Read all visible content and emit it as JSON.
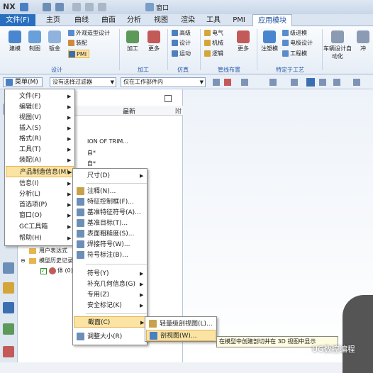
{
  "titlebar": {
    "logo": "NX",
    "window_menu": "窗口"
  },
  "tabs": [
    "文件(F)",
    "主页",
    "曲线",
    "曲面",
    "分析",
    "视图",
    "渲染",
    "工具",
    "PMI",
    "应用模块"
  ],
  "ribbon": {
    "design": {
      "label": "设计",
      "big": [
        "建模",
        "制图",
        "钣金"
      ],
      "small": [
        "外观造型设计",
        "装配",
        "PMI"
      ]
    },
    "process": {
      "label": "加工",
      "big": [
        "加工",
        "更多"
      ]
    },
    "sim": {
      "label": "仿真",
      "small": [
        "高级",
        "设计",
        "运动"
      ]
    },
    "pipe": {
      "label": "管线布置",
      "small": [
        "电气",
        "机械",
        "逻辑"
      ],
      "more": "更多"
    },
    "special": {
      "label": "特定于工艺",
      "big": [
        "注塑模"
      ],
      "small": [
        "级进模",
        "电极设计",
        "工程模"
      ]
    },
    "extra": {
      "items": [
        "车辆设计自动化",
        "冲"
      ]
    }
  },
  "cmdbar": {
    "menu": "菜单(M)",
    "filter": "没有选择过滤器",
    "scope": "仅在工作部件内"
  },
  "nav": {
    "col_latest": "最新",
    "col_p": "附",
    "rows": [
      "ION OF TRIM...",
      "自*",
      "自*"
    ],
    "user_expr": "用户表达式",
    "history": "模型历史记录",
    "body": "体 (0)"
  },
  "menu1": [
    "文件(F)",
    "编辑(E)",
    "视图(V)",
    "插入(S)",
    "格式(R)",
    "工具(T)",
    "装配(A)",
    "产品制造信息(M)",
    "信息(I)",
    "分析(L)",
    "首选项(P)",
    "窗口(O)",
    "GC工具箱",
    "帮助(H)"
  ],
  "menu2": {
    "items": [
      "尺寸(D)",
      "注释(N)...",
      "特征控制框(F)...",
      "基准特征符号(A)...",
      "基准目标(T)...",
      "表面粗糙度(S)...",
      "焊接符号(W)...",
      "符号标注(B)...",
      "符号(Y)",
      "补充几何信息(G)",
      "专用(Z)",
      "安全标记(K)",
      "截面(C)",
      "调整大小(R)"
    ]
  },
  "menu3": [
    "轻量级剖视图(L)...",
    "剖视图(W)..."
  ],
  "tooltip": "在模型中创建剖切并在 3D 视图中显示",
  "watermark": "UG数控编程"
}
